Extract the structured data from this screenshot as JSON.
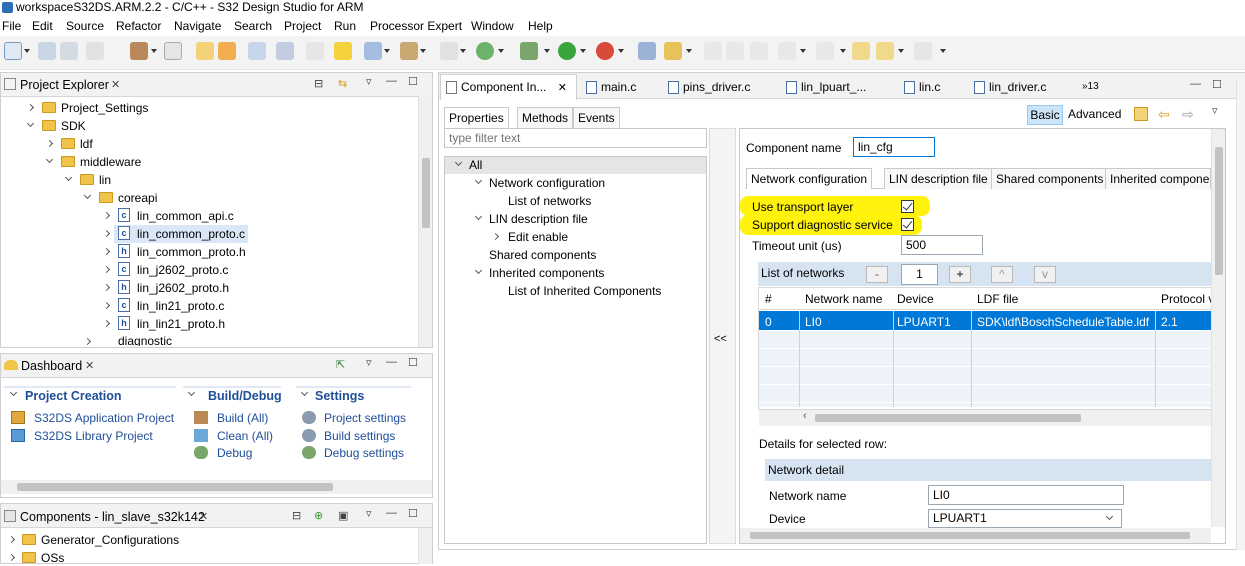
{
  "window": {
    "title": "workspaceS32DS.ARM.2.2 - C/C++ - S32 Design Studio for ARM"
  },
  "menu": [
    "File",
    "Edit",
    "Source",
    "Refactor",
    "Navigate",
    "Search",
    "Project",
    "Run",
    "Processor Expert",
    "Window",
    "Help"
  ],
  "project_explorer": {
    "title": "Project Explorer",
    "items": [
      "Project_Settings",
      "SDK",
      "ldf",
      "middleware",
      "lin",
      "coreapi",
      "lin_common_api.c",
      "lin_common_proto.c",
      "lin_common_proto.h",
      "lin_j2602_proto.c",
      "lin_j2602_proto.h",
      "lin_lin21_proto.c",
      "lin_lin21_proto.h",
      "diagnostic"
    ]
  },
  "dashboard": {
    "title": "Dashboard",
    "project_creation": {
      "title": "Project Creation",
      "items": [
        "S32DS Application Project",
        "S32DS Library Project"
      ]
    },
    "build_debug": {
      "title": "Build/Debug",
      "items": [
        "Build  (All)",
        "Clean  (All)",
        "Debug"
      ]
    },
    "settings": {
      "title": "Settings",
      "items": [
        "Project settings",
        "Build settings",
        "Debug settings"
      ]
    }
  },
  "components": {
    "title": "Components - lin_slave_s32k142",
    "items": [
      "Generator_Configurations",
      "OSs"
    ]
  },
  "editor_tabs": [
    "Component In...",
    "main.c",
    "pins_driver.c",
    "lin_lpuart_...",
    "lin.c",
    "lin_driver.c",
    "»13"
  ],
  "inspector": {
    "tabs": [
      "Properties",
      "Methods",
      "Events"
    ],
    "modes": {
      "basic": "Basic",
      "advanced": "Advanced"
    },
    "filter_placeholder": "type filter text",
    "tree": [
      "All",
      "Network configuration",
      "List of networks",
      "LIN description file",
      "Edit enable",
      "Shared components",
      "Inherited components",
      "List of Inherited Components"
    ],
    "collapse_label": "<<",
    "component_name_label": "Component name",
    "component_name_value": "lin_cfg",
    "subtabs": [
      "Network configuration",
      "LIN description file",
      "Shared components",
      "Inherited compone"
    ],
    "use_transport_layer": "Use transport layer",
    "support_diagnostic": "Support diagnostic service",
    "timeout_label": "Timeout unit (us)",
    "timeout_value": "500",
    "list_of_networks": "List of networks",
    "list_controls": {
      "minus": "-",
      "count": "1",
      "plus": "+",
      "up": "^",
      "down": "v"
    },
    "grid_headers": [
      "#",
      "Network name",
      "Device",
      "LDF file",
      "Protocol v"
    ],
    "grid_row": [
      "0",
      "LI0",
      "LPUART1",
      "SDK\\ldf\\BoschScheduleTable.ldf",
      "2.1"
    ],
    "details_label": "Details for selected row:",
    "network_detail": "Network detail",
    "network_name_label": "Network name",
    "network_name_value": "LI0",
    "device_label": "Device",
    "device_value": "LPUART1"
  },
  "colors": {
    "accent": "#0078d7",
    "highlight": "#fff200",
    "link": "#1f4f99"
  }
}
